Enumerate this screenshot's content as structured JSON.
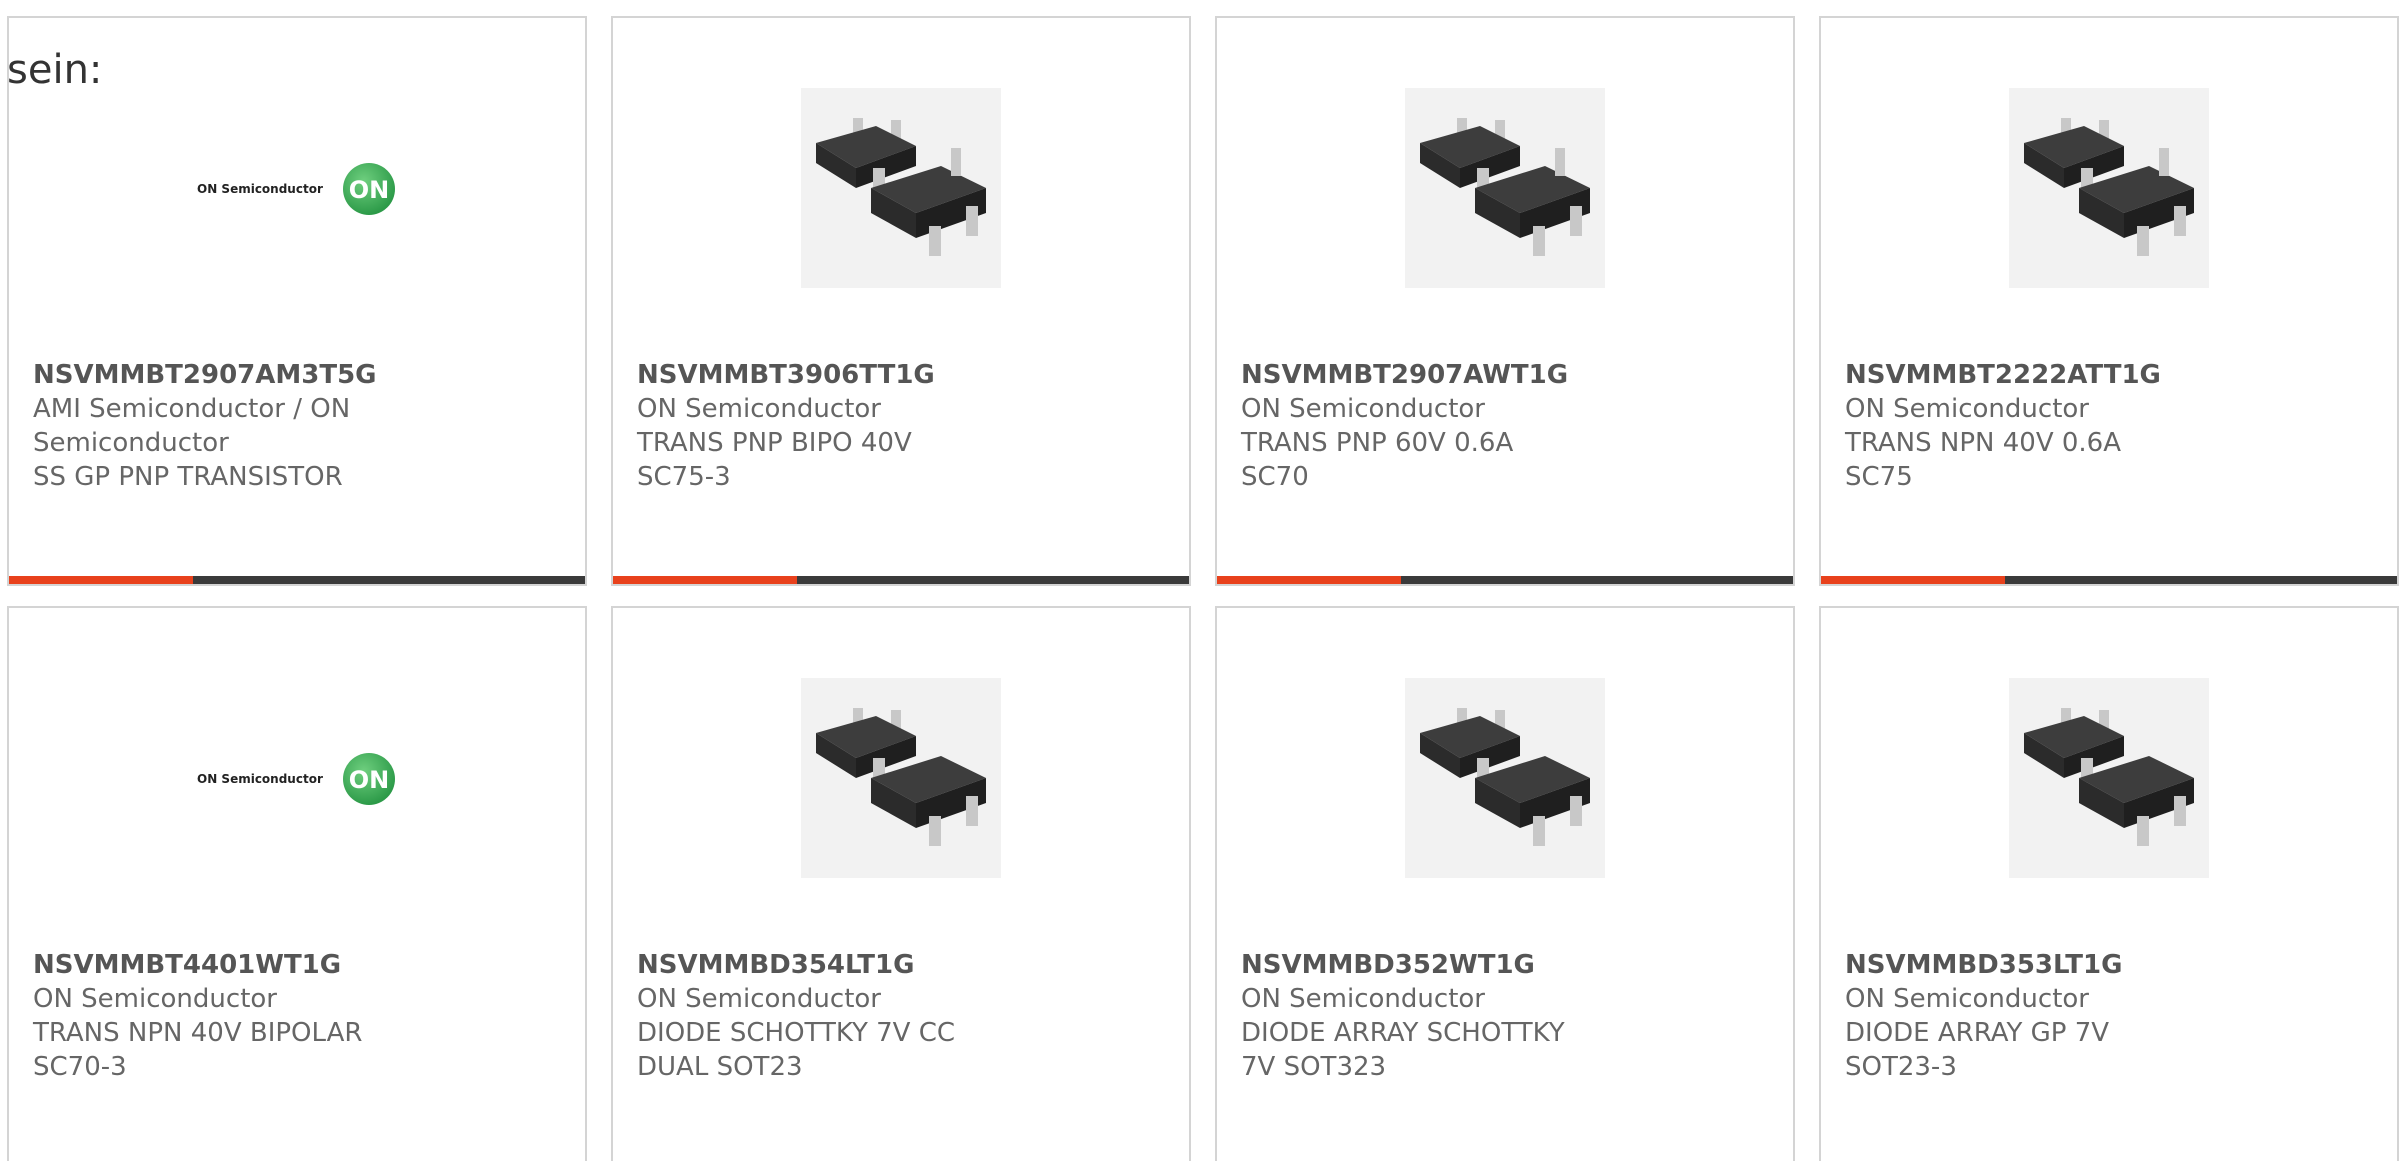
{
  "intro_text": "sein:",
  "colors": {
    "accent_bar": "#e8411c",
    "dark_bar": "#3a3a3a",
    "card_border": "#d4d4d4",
    "text": "#666666",
    "logo_green": "#2c9a48"
  },
  "logo": {
    "wordmark": "ON Semiconductor",
    "mark": "ON"
  },
  "products": [
    {
      "part_number": "NSVMMBT2907AM3T5G",
      "manufacturer": "AMI Semiconductor / ON Semiconductor",
      "description": "SS GP PNP TRANSISTOR",
      "image": "on-semiconductor-logo-icon"
    },
    {
      "part_number": "NSVMMBT3906TT1G",
      "manufacturer": "ON Semiconductor",
      "description": "TRANS PNP BIPO 40V SC75-3",
      "image": "transistor-package-icon"
    },
    {
      "part_number": "NSVMMBT2907AWT1G",
      "manufacturer": "ON Semiconductor",
      "description": "TRANS PNP 60V 0.6A SC70",
      "image": "transistor-package-icon"
    },
    {
      "part_number": "NSVMMBT2222ATT1G",
      "manufacturer": "ON Semiconductor",
      "description": "TRANS NPN 40V 0.6A SC75",
      "image": "transistor-package-icon"
    },
    {
      "part_number": "NSVMMBT4401WT1G",
      "manufacturer": "ON Semiconductor",
      "description": "TRANS NPN 40V BIPOLAR SC70-3",
      "image": "on-semiconductor-logo-icon"
    },
    {
      "part_number": "NSVMMBD354LT1G",
      "manufacturer": "ON Semiconductor",
      "description": "DIODE SCHOTTKY 7V CC DUAL SOT23",
      "image": "diode-package-icon"
    },
    {
      "part_number": "NSVMMBD352WT1G",
      "manufacturer": "ON Semiconductor",
      "description": "DIODE ARRAY SCHOTTKY 7V SOT323",
      "image": "diode-package-icon"
    },
    {
      "part_number": "NSVMMBD353LT1G",
      "manufacturer": "ON Semiconductor",
      "description": "DIODE ARRAY GP 7V SOT23-3",
      "image": "diode-package-icon"
    }
  ]
}
